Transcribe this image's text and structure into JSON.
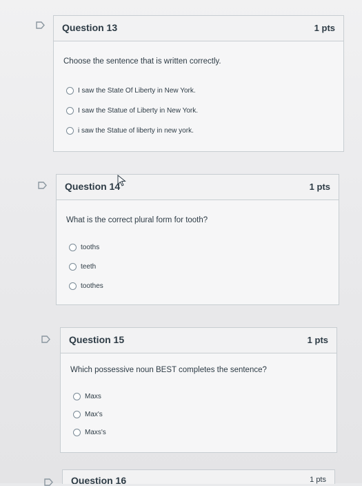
{
  "questions": [
    {
      "title": "Question 13",
      "points": "1 pts",
      "prompt": "Choose the sentence that is written correctly.",
      "answers": [
        "I saw the State Of Liberty in New York.",
        "I saw the Statue of Liberty in New York.",
        "i saw the Statue of liberty in new york."
      ]
    },
    {
      "title": "Question 14",
      "points": "1 pts",
      "prompt": "What is the correct plural form for tooth?",
      "answers": [
        "tooths",
        "teeth",
        "toothes"
      ]
    },
    {
      "title": "Question 15",
      "points": "1 pts",
      "prompt": "Which possessive noun BEST completes the sentence?",
      "answers": [
        "Maxs",
        "Max's",
        "Maxs's"
      ]
    },
    {
      "title": "Question 16",
      "points": "1 pts"
    }
  ],
  "icons": {
    "flag": "flag-icon",
    "cursor": "mouse-pointer-icon"
  },
  "colors": {
    "text": "#2d3b45",
    "border": "#c7cdd1",
    "flag": "#8a969f"
  }
}
